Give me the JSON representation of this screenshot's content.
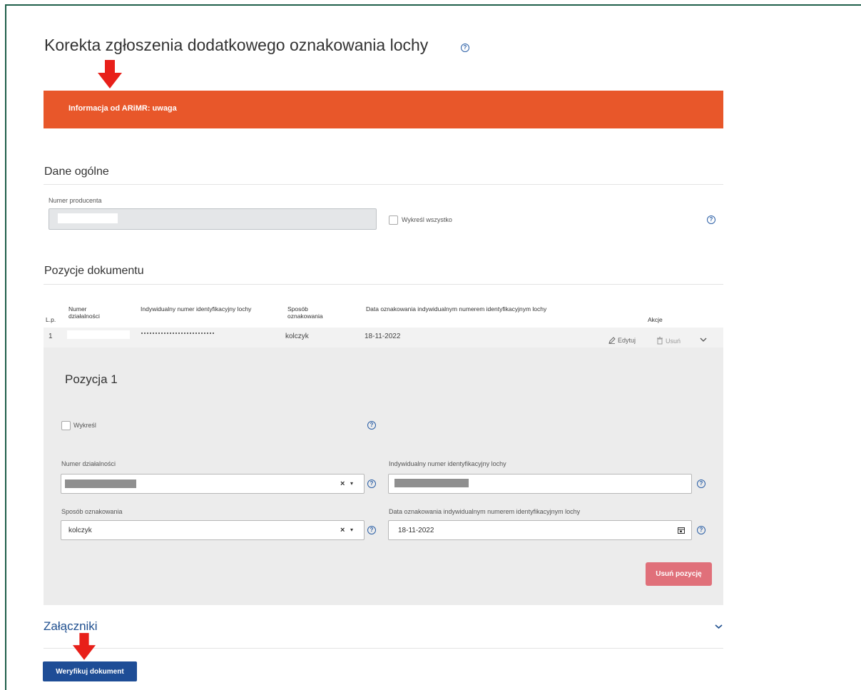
{
  "page": {
    "title": "Korekta zgłoszenia dodatkowego oznakowania lochy"
  },
  "banner": {
    "text": "Informacja od ARiMR: uwaga",
    "color": "#e8572a"
  },
  "general": {
    "section_title": "Dane ogólne",
    "producer_label": "Numer producenta",
    "producer_value": "",
    "strike_all_label": "Wykreśl wszystko"
  },
  "positions": {
    "section_title": "Pozycje dokumentu",
    "columns": {
      "lp": "L.p.",
      "activity_number": "Numer działalności",
      "sow_id": "Indywidualny numer identyfikacyjny lochy",
      "marking_method": "Sposób oznakowania",
      "marking_date": "Data oznakowania indywidualnym numerem identyfikacyjnym lochy",
      "actions": "Akcje"
    },
    "rows": [
      {
        "lp": "1",
        "activity_number": "",
        "sow_id": "",
        "marking_method": "kolczyk",
        "marking_date": "18-11-2022",
        "edit_label": "Edytuj",
        "delete_label": "Usuń"
      }
    ]
  },
  "detail": {
    "title": "Pozycja 1",
    "strike_label": "Wykreśl",
    "activity_label": "Numer działalności",
    "activity_value": "",
    "sow_id_label": "Indywidualny numer identyfikacyjny lochy",
    "sow_id_value": "",
    "method_label": "Sposób oznakowania",
    "method_value": "kolczyk",
    "date_label": "Data oznakowania indywidualnym numerem identyfikacyjnym lochy",
    "date_value": "18-11-2022",
    "remove_button": "Usuń pozycję"
  },
  "attachments": {
    "title": "Załączniki"
  },
  "footer": {
    "verify_button": "Weryfikuj dokument"
  },
  "icons": {
    "help": "help-circle-icon",
    "arrow": "red-arrow-down-icon",
    "edit": "pencil-icon",
    "delete": "trash-icon",
    "expand": "chevron-down-icon",
    "clear": "clear-x-icon",
    "caret": "caret-down-icon",
    "calendar": "calendar-icon"
  }
}
